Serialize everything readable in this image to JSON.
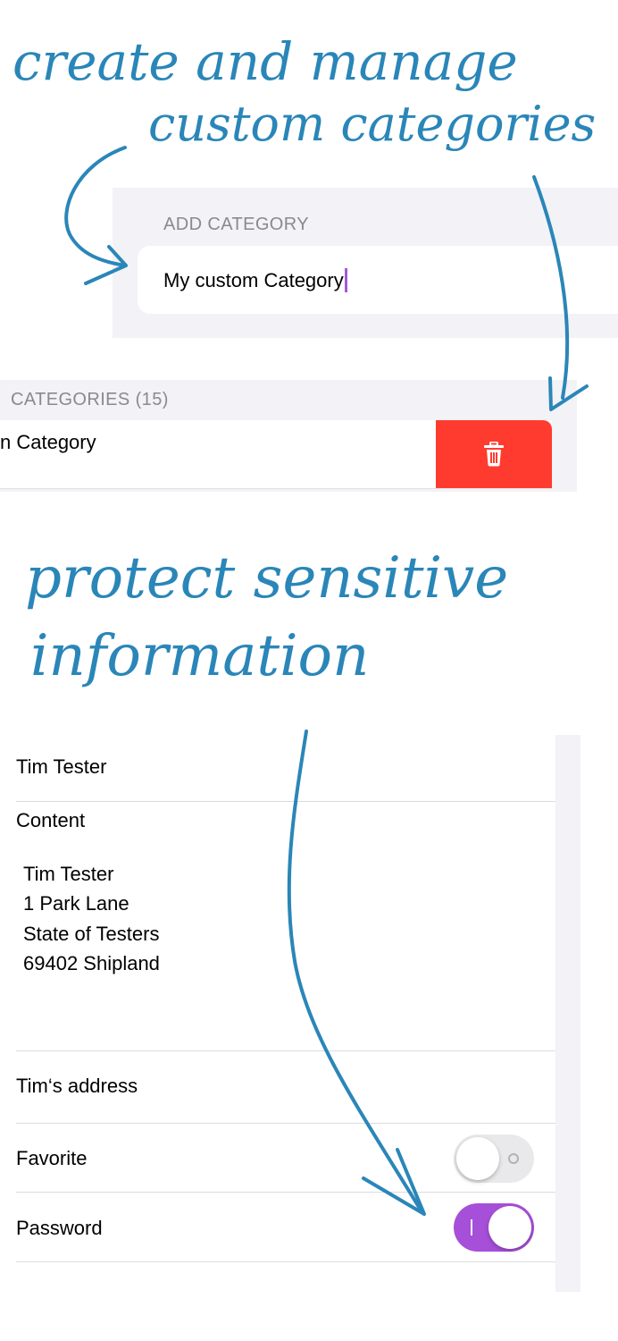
{
  "captions": {
    "top_line1": "create and manage",
    "top_line2": "custom categories",
    "bottom_line1": "protect sensitive",
    "bottom_line2": "information"
  },
  "add_category": {
    "header": "ADD CATEGORY",
    "value": "My custom Category"
  },
  "categories": {
    "header": "CATEGORIES (15)",
    "row_label": "n Category",
    "delete_icon": "trash-icon"
  },
  "detail": {
    "title": "Tim Tester",
    "content_label": "Content",
    "content_lines": [
      "Tim Tester",
      "1 Park Lane",
      "State of Testers",
      "69402 Shipland"
    ],
    "note": "Tim‘s address",
    "favorite_label": "Favorite",
    "favorite_on": false,
    "password_label": "Password",
    "password_on": true
  },
  "colors": {
    "caption": "#2a86b8",
    "delete": "#ff3b30",
    "toggle_on": "#a64fd9",
    "caret": "#a259d9"
  }
}
